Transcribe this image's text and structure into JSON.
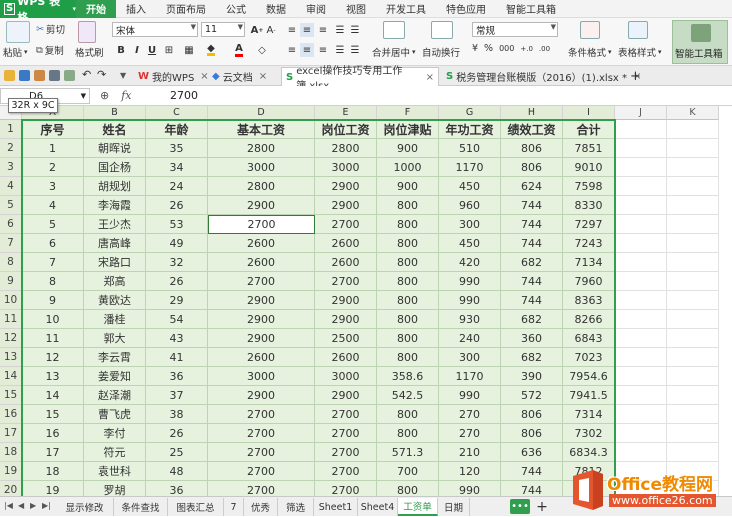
{
  "app": {
    "name": "WPS 表格",
    "logo": "S"
  },
  "menu": {
    "items": [
      "开始",
      "插入",
      "页面布局",
      "公式",
      "数据",
      "审阅",
      "视图",
      "开发工具",
      "特色应用",
      "智能工具箱"
    ],
    "active": 0
  },
  "ribbon": {
    "paste": "粘贴",
    "cut": "剪切",
    "copy": "复制",
    "format_painter": "格式刷",
    "font_name": "宋体",
    "font_size": "11",
    "number_format": "常规",
    "merge_center": "合并居中",
    "auto_wrap": "自动换行",
    "conditional_format": "条件格式",
    "table_style": "表格样式",
    "smart_toolbox": "智能工具箱",
    "bold": "B",
    "italic": "I",
    "underline": "U",
    "font_color_letter": "A",
    "grow_font": "A",
    "currency_symbol": "¥",
    "percent_symbol": "%",
    "thousands_sep": "000",
    "inc_decimal": "+.0",
    "dec_decimal": ".00"
  },
  "tabs": [
    {
      "label": "我的WPS"
    },
    {
      "label": "云文档"
    },
    {
      "label": "excel操作技巧专用工作簿.xlsx"
    },
    {
      "label": "税务管理台账模版（2016）(1).xlsx *"
    }
  ],
  "formula": {
    "namebox": "D6",
    "tooltip": "32R x 9C",
    "fx": "fx",
    "value": "2700"
  },
  "columns": [
    "A",
    "B",
    "C",
    "D",
    "E",
    "F",
    "G",
    "H",
    "I",
    "J",
    "K"
  ],
  "rows": [
    "1",
    "2",
    "3",
    "4",
    "5",
    "6",
    "7",
    "8",
    "9",
    "10",
    "11",
    "12",
    "13",
    "14",
    "15",
    "16",
    "17",
    "18",
    "19",
    "20"
  ],
  "table": {
    "headers": [
      "序号",
      "姓名",
      "年龄",
      "基本工资",
      "岗位工资",
      "岗位津贴",
      "年功工资",
      "绩效工资",
      "合计"
    ],
    "data": [
      [
        "1",
        "朝晖说",
        "35",
        "2800",
        "2800",
        "900",
        "510",
        "806",
        "7851"
      ],
      [
        "2",
        "国企杨",
        "34",
        "3000",
        "3000",
        "1000",
        "1170",
        "806",
        "9010"
      ],
      [
        "3",
        "胡规划",
        "24",
        "2800",
        "2900",
        "900",
        "450",
        "624",
        "7598"
      ],
      [
        "4",
        "李海霞",
        "26",
        "2900",
        "2900",
        "800",
        "960",
        "744",
        "8330"
      ],
      [
        "5",
        "王少杰",
        "53",
        "2700",
        "2700",
        "800",
        "300",
        "744",
        "7297"
      ],
      [
        "6",
        "唐高峰",
        "49",
        "2600",
        "2600",
        "800",
        "450",
        "744",
        "7243"
      ],
      [
        "7",
        "宋路口",
        "32",
        "2600",
        "2600",
        "800",
        "420",
        "682",
        "7134"
      ],
      [
        "8",
        "郑高",
        "26",
        "2700",
        "2700",
        "800",
        "990",
        "744",
        "7960"
      ],
      [
        "9",
        "黄欧达",
        "29",
        "2900",
        "2900",
        "800",
        "990",
        "744",
        "8363"
      ],
      [
        "10",
        "潘桂",
        "54",
        "2900",
        "2900",
        "800",
        "930",
        "682",
        "8266"
      ],
      [
        "11",
        "郭大",
        "43",
        "2900",
        "2500",
        "800",
        "240",
        "360",
        "6843"
      ],
      [
        "12",
        "李云霄",
        "41",
        "2600",
        "2600",
        "800",
        "300",
        "682",
        "7023"
      ],
      [
        "13",
        "姜爱知",
        "36",
        "3000",
        "3000",
        "358.6",
        "1170",
        "390",
        "7954.6"
      ],
      [
        "14",
        "赵泽潮",
        "37",
        "2900",
        "2900",
        "542.5",
        "990",
        "572",
        "7941.5"
      ],
      [
        "15",
        "曹飞虎",
        "38",
        "2700",
        "2700",
        "800",
        "270",
        "806",
        "7314"
      ],
      [
        "16",
        "李付",
        "26",
        "2700",
        "2700",
        "800",
        "270",
        "806",
        "7302"
      ],
      [
        "17",
        "符元",
        "25",
        "2700",
        "2700",
        "571.3",
        "210",
        "636",
        "6834.3"
      ],
      [
        "18",
        "袁世科",
        "48",
        "2700",
        "2700",
        "700",
        "120",
        "744",
        "7812"
      ],
      [
        "19",
        "罗胡",
        "36",
        "2700",
        "2700",
        "800",
        "990",
        "744",
        ""
      ]
    ]
  },
  "active_cell": {
    "row": 6,
    "col": "D"
  },
  "sheets": [
    "显示修改",
    "条件查找",
    "图表汇总",
    "7",
    "优秀",
    "筛选",
    "Sheet1",
    "Sheet4",
    "工资单",
    "日期"
  ],
  "active_sheet": "工资单",
  "more_tabs": "•••",
  "add_sheet": "+",
  "watermark": {
    "brand": "Office教程网",
    "url": "www.office26.com"
  },
  "colors": {
    "accent": "#2f9e4e",
    "cell_fill": "#e6f2de",
    "header_fill": "#e3ecd6"
  }
}
